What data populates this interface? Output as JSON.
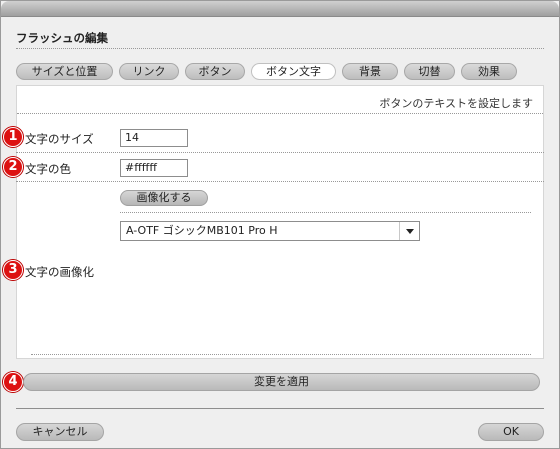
{
  "dialog": {
    "title": "フラッシュの編集"
  },
  "tabs": [
    {
      "label": "サイズと位置"
    },
    {
      "label": "リンク"
    },
    {
      "label": "ボタン"
    },
    {
      "label": "ボタン文字",
      "active": true
    },
    {
      "label": "背景"
    },
    {
      "label": "切替"
    },
    {
      "label": "効果"
    }
  ],
  "panel": {
    "hint": "ボタンのテキストを設定します",
    "font_size": {
      "marker": "1",
      "label": "文字のサイズ",
      "value": "14"
    },
    "font_color": {
      "marker": "2",
      "label": "文字の色",
      "value": "#ffffff"
    },
    "image_text": {
      "marker": "3",
      "label": "文字の画像化",
      "button": "画像化する",
      "font_select": "A-OTF ゴシックMB101 Pro H"
    }
  },
  "apply": {
    "marker": "4",
    "label": "変更を適用"
  },
  "footer": {
    "cancel": "キャンセル",
    "ok": "OK"
  },
  "colors": {
    "marker_red": "#dd1111",
    "active_tab": "#ffffff"
  }
}
